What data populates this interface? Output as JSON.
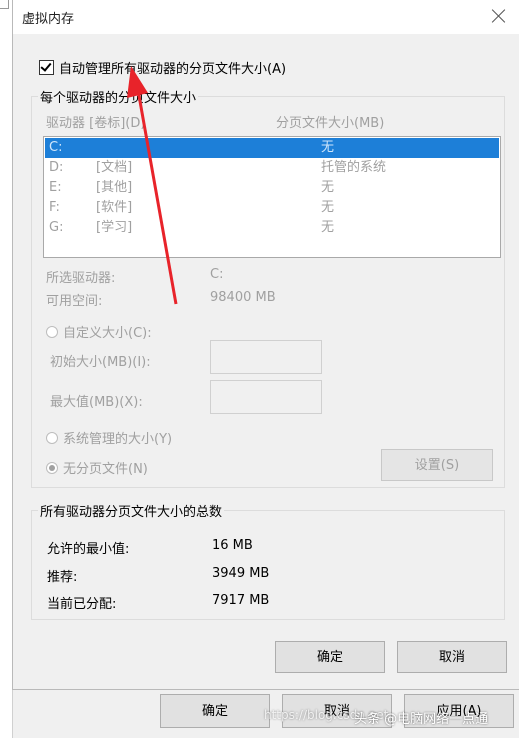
{
  "window": {
    "title": "虚拟内存",
    "close_icon": "close-icon"
  },
  "auto_manage": {
    "label": "自动管理所有驱动器的分页文件大小(A)",
    "checked": true
  },
  "per_drive": {
    "legend": "每个驱动器的分页文件大小",
    "col_drive": "驱动器 [卷标](D)",
    "col_size": "分页文件大小(MB)",
    "rows": [
      {
        "drive": "C:",
        "label": "",
        "size": "无"
      },
      {
        "drive": "D:",
        "label": "[文档]",
        "size": "托管的系统"
      },
      {
        "drive": "E:",
        "label": "[其他]",
        "size": "无"
      },
      {
        "drive": "F:",
        "label": "[软件]",
        "size": "无"
      },
      {
        "drive": "G:",
        "label": "[学习]",
        "size": "无"
      }
    ],
    "selected_drive_label": "所选驱动器:",
    "selected_drive_value": "C:",
    "free_space_label": "可用空间:",
    "free_space_value": "98400 MB",
    "custom_size_label": "自定义大小(C):",
    "initial_size_label": "初始大小(MB)(I):",
    "initial_size_value": "",
    "max_size_label": "最大值(MB)(X):",
    "max_size_value": "",
    "system_managed_label": "系统管理的大小(Y)",
    "no_paging_label": "无分页文件(N)",
    "set_button": "设置(S)"
  },
  "totals": {
    "legend": "所有驱动器分页文件大小的总数",
    "min_label": "允许的最小值:",
    "min_value": "16 MB",
    "recommended_label": "推荐:",
    "recommended_value": "3949 MB",
    "current_label": "当前已分配:",
    "current_value": "7917 MB"
  },
  "dialog_buttons": {
    "ok": "确定",
    "cancel": "取消"
  },
  "parent_buttons": {
    "ok": "确定",
    "cancel": "取消",
    "apply": "应用(A)"
  },
  "watermark": {
    "url": "https://blog.csdn.net",
    "brand": "头条 @电脑网络一点通"
  }
}
